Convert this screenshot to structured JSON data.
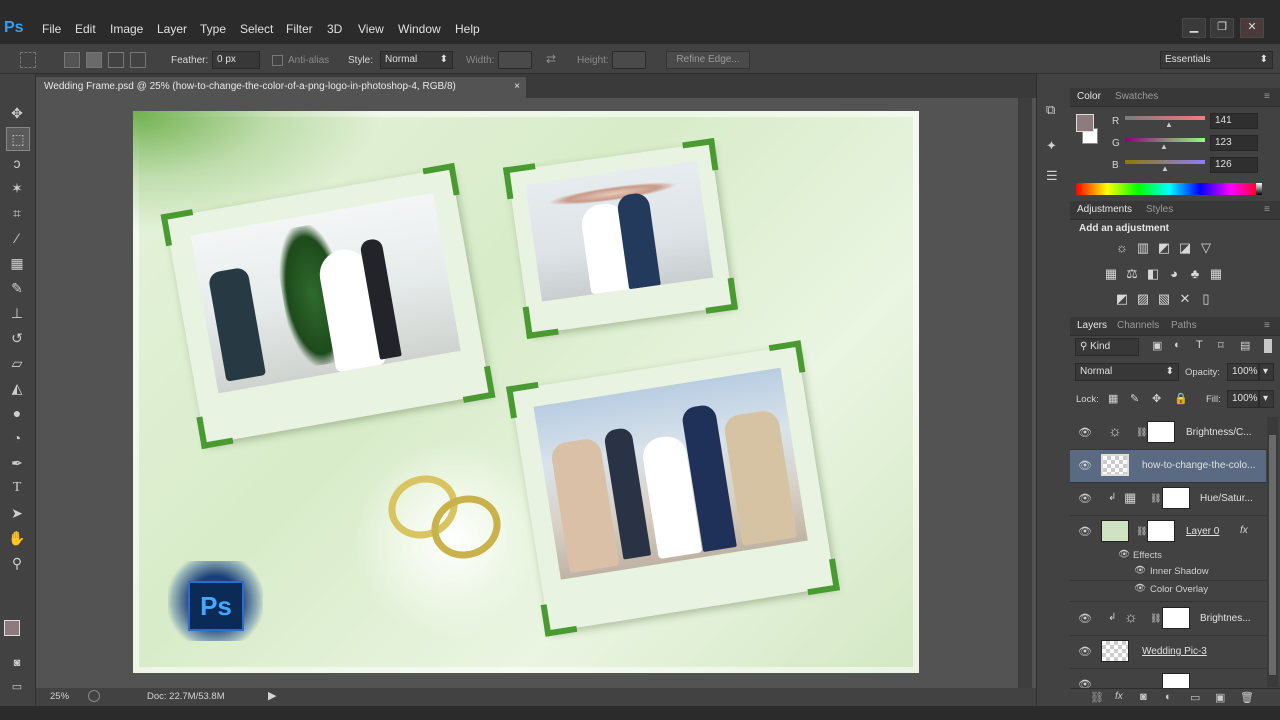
{
  "app": {
    "logo": "Ps"
  },
  "menu": [
    "File",
    "Edit",
    "Image",
    "Layer",
    "Type",
    "Select",
    "Filter",
    "3D",
    "View",
    "Window",
    "Help"
  ],
  "window_controls": {
    "minimize": "▁",
    "restore": "❐",
    "close": "✕"
  },
  "options": {
    "feather_label": "Feather:",
    "feather_value": "0 px",
    "antialias_label": "Anti-alias",
    "style_label": "Style:",
    "style_value": "Normal",
    "width_label": "Width:",
    "height_label": "Height:",
    "refine_label": "Refine Edge...",
    "workspace_value": "Essentials"
  },
  "document_tab": {
    "title": "Wedding Frame.psd @ 25% (how-to-change-the-color-of-a-png-logo-in-photoshop-4, RGB/8)",
    "close": "×"
  },
  "status": {
    "zoom": "25%",
    "doc": "Doc: 22.7M/53.8M"
  },
  "color_panel": {
    "tabs": [
      "Color",
      "Swatches"
    ],
    "r_label": "R",
    "g_label": "G",
    "b_label": "B",
    "r": "141",
    "g": "123",
    "b": "126",
    "foreground": "#8d7b7e"
  },
  "adjustments_panel": {
    "tabs": [
      "Adjustments",
      "Styles"
    ],
    "title": "Add an adjustment"
  },
  "layers_panel": {
    "tabs": [
      "Layers",
      "Channels",
      "Paths"
    ],
    "filter_kind": "Kind",
    "blend_mode": "Normal",
    "opacity_label": "Opacity:",
    "opacity": "100%",
    "lock_label": "Lock:",
    "fill_label": "Fill:",
    "fill": "100%",
    "layers": [
      {
        "name": "Brightness/C...",
        "selected": false
      },
      {
        "name": "how-to-change-the-colo...",
        "selected": true
      },
      {
        "name": "Hue/Satur...",
        "selected": false
      },
      {
        "name": "Layer 0",
        "selected": false
      },
      {
        "name": "Brightnes...",
        "selected": false
      },
      {
        "name": "Wedding Pic-3",
        "selected": false
      }
    ],
    "effects_label": "Effects",
    "effects": [
      "Inner Shadow",
      "Color Overlay"
    ],
    "fx": "fx"
  },
  "canvas": {
    "badge_text": "Ps"
  },
  "colors": {
    "accent": "#3d9be9",
    "selection": "#5a6a82",
    "frame_green": "#4a9a32"
  }
}
